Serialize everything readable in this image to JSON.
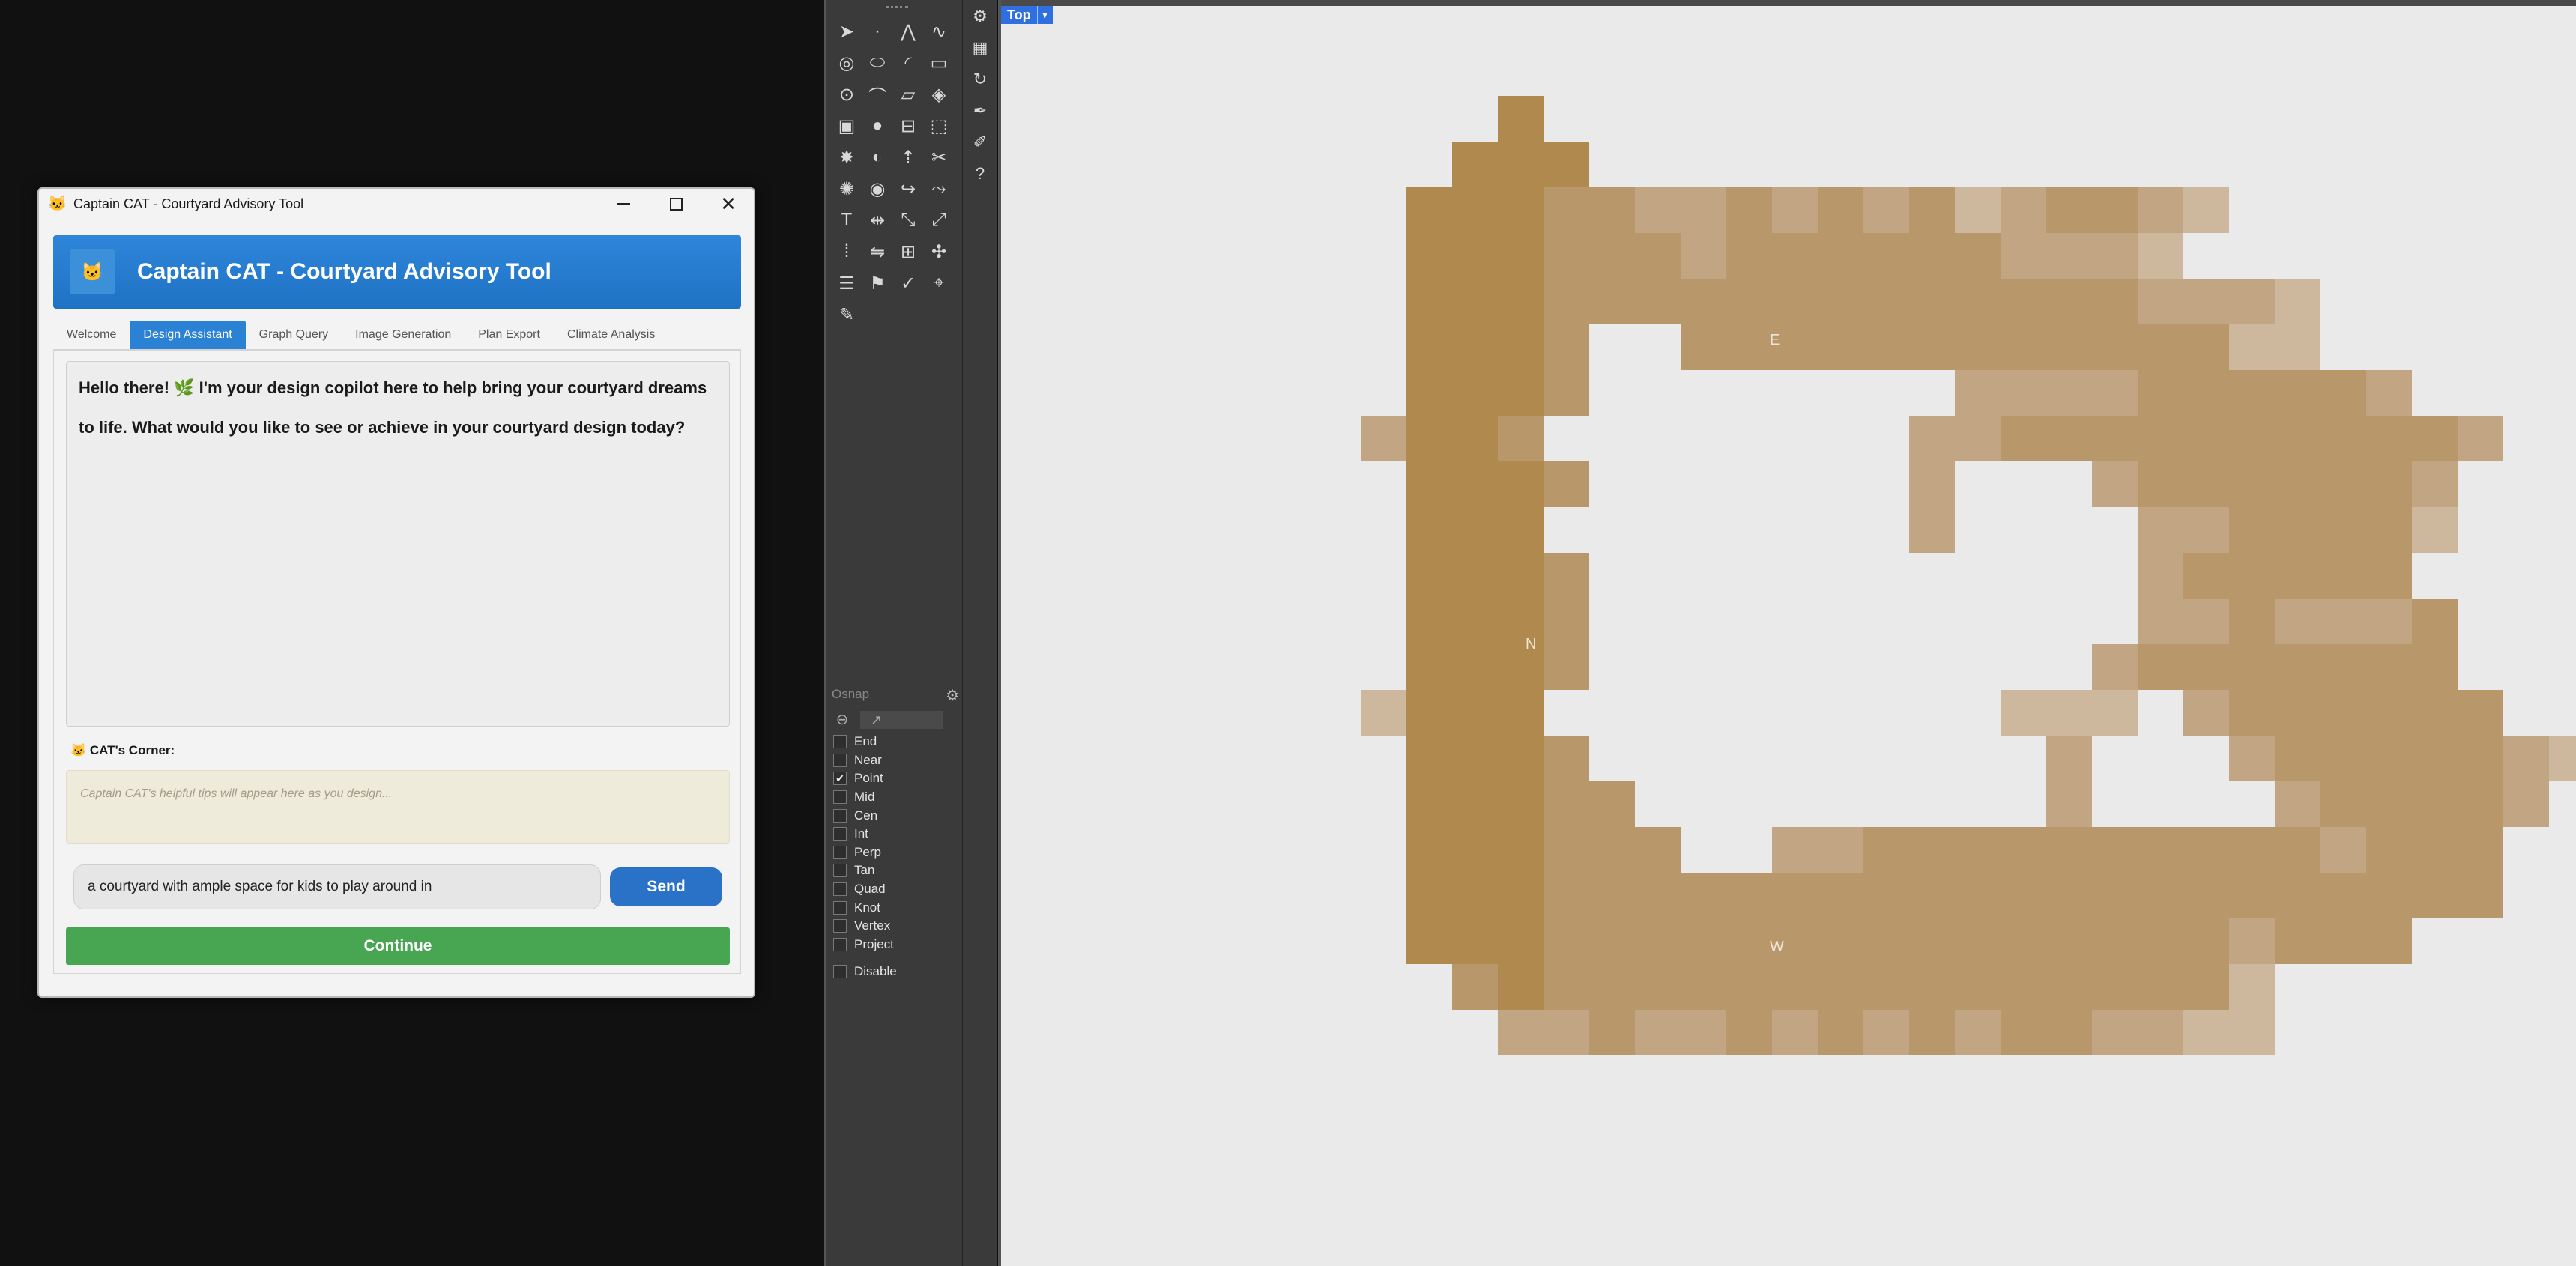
{
  "window": {
    "title": "Captain CAT - Courtyard Advisory Tool",
    "icon": "cat-app-icon",
    "controls": {
      "minimize": "minimize-icon",
      "maximize": "maximize-icon",
      "close": "close-icon"
    }
  },
  "header": {
    "title": "Captain CAT - Courtyard Advisory Tool",
    "logo": "cat-logo-icon"
  },
  "tabs": [
    {
      "label": "Welcome"
    },
    {
      "label": "Design Assistant",
      "active": true
    },
    {
      "label": "Graph Query"
    },
    {
      "label": "Image Generation"
    },
    {
      "label": "Plan Export"
    },
    {
      "label": "Climate Analysis"
    }
  ],
  "chat": {
    "message": "Hello there! 🌿 I'm your design copilot here to help bring your courtyard dreams to life. What would you like to see or achieve in your courtyard design today?"
  },
  "corner": {
    "label": "🐱 CAT's Corner:",
    "tip": "Captain CAT's helpful tips will appear here as you design..."
  },
  "input": {
    "value": "a courtyard with ample space for kids to play around in",
    "send_label": "Send"
  },
  "continue_label": "Continue",
  "toolbar": {
    "tools": [
      "select-arrow-icon",
      "point-icon",
      "polyline-icon",
      "curve-icon",
      "circle-icon",
      "ellipse-icon",
      "arc-icon",
      "rectangle-icon",
      "circle-center-icon",
      "fillet-icon",
      "surface-icon",
      "surface-edit-icon",
      "box-icon",
      "sphere-icon",
      "cylinder-icon",
      "solid-edit-icon",
      "explode-icon",
      "boolean-icon",
      "extrude-icon",
      "trim-icon",
      "lights-icon",
      "render-icon",
      "join-icon",
      "split-icon",
      "text-icon",
      "dimension-icon",
      "transform-icon",
      "scale-icon",
      "array-icon",
      "mirror-icon",
      "grid-icon",
      "grip-icon",
      "layer-icon",
      "properties-icon",
      "check-icon",
      "analyze-icon",
      "paint-icon"
    ],
    "side_tools": [
      "settings-icon",
      "plugin-icon",
      "redo-icon",
      "pen-icon",
      "brush-icon",
      "help-icon"
    ]
  },
  "osnap": {
    "title": "Osnap",
    "items": [
      {
        "label": "End",
        "checked": false
      },
      {
        "label": "Near",
        "checked": false
      },
      {
        "label": "Point",
        "checked": true
      },
      {
        "label": "Mid",
        "checked": false
      },
      {
        "label": "Cen",
        "checked": false
      },
      {
        "label": "Int",
        "checked": false
      },
      {
        "label": "Perp",
        "checked": false
      },
      {
        "label": "Tan",
        "checked": false
      },
      {
        "label": "Quad",
        "checked": false
      },
      {
        "label": "Knot",
        "checked": false
      },
      {
        "label": "Vertex",
        "checked": false
      },
      {
        "label": "Project",
        "checked": false
      }
    ],
    "disable_label": "Disable"
  },
  "viewport": {
    "name": "Top",
    "labels": {
      "east": "E",
      "north": "N",
      "west": "W"
    },
    "palette": [
      "#b0894e",
      "#b8986a",
      "#c2a684",
      "#cdb89d",
      "#d6c8b5"
    ]
  }
}
